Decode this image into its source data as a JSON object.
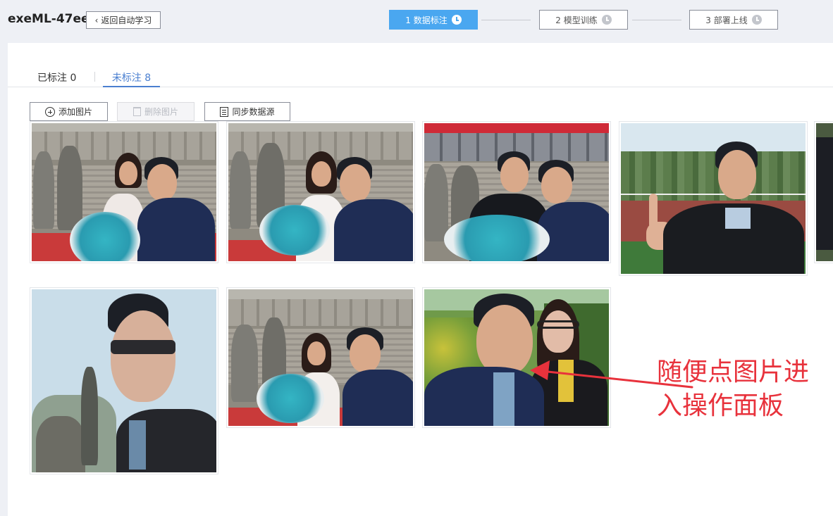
{
  "app": {
    "title": "exeML-47ee"
  },
  "header": {
    "back_label": "返回自动学习",
    "steps": [
      {
        "label": "1 数据标注",
        "active": true
      },
      {
        "label": "2 模型训练",
        "active": false
      },
      {
        "label": "3 部署上线",
        "active": false
      }
    ]
  },
  "tabs": {
    "labeled": "已标注 0",
    "unlabeled": "未标注 8"
  },
  "toolbar": {
    "add_label": "添加图片",
    "delete_label": "删除图片",
    "sync_label": "同步数据源"
  },
  "images": [
    {
      "name": "photo-1"
    },
    {
      "name": "photo-2"
    },
    {
      "name": "photo-3"
    },
    {
      "name": "photo-4"
    },
    {
      "name": "photo-5"
    },
    {
      "name": "photo-6"
    },
    {
      "name": "photo-7"
    },
    {
      "name": "photo-8"
    }
  ],
  "annotation": {
    "text": "随便点图片进入操作面板",
    "color": "#e8323c"
  },
  "colors": {
    "accent": "#4aa7f0",
    "tab_active": "#4a7fd0"
  }
}
